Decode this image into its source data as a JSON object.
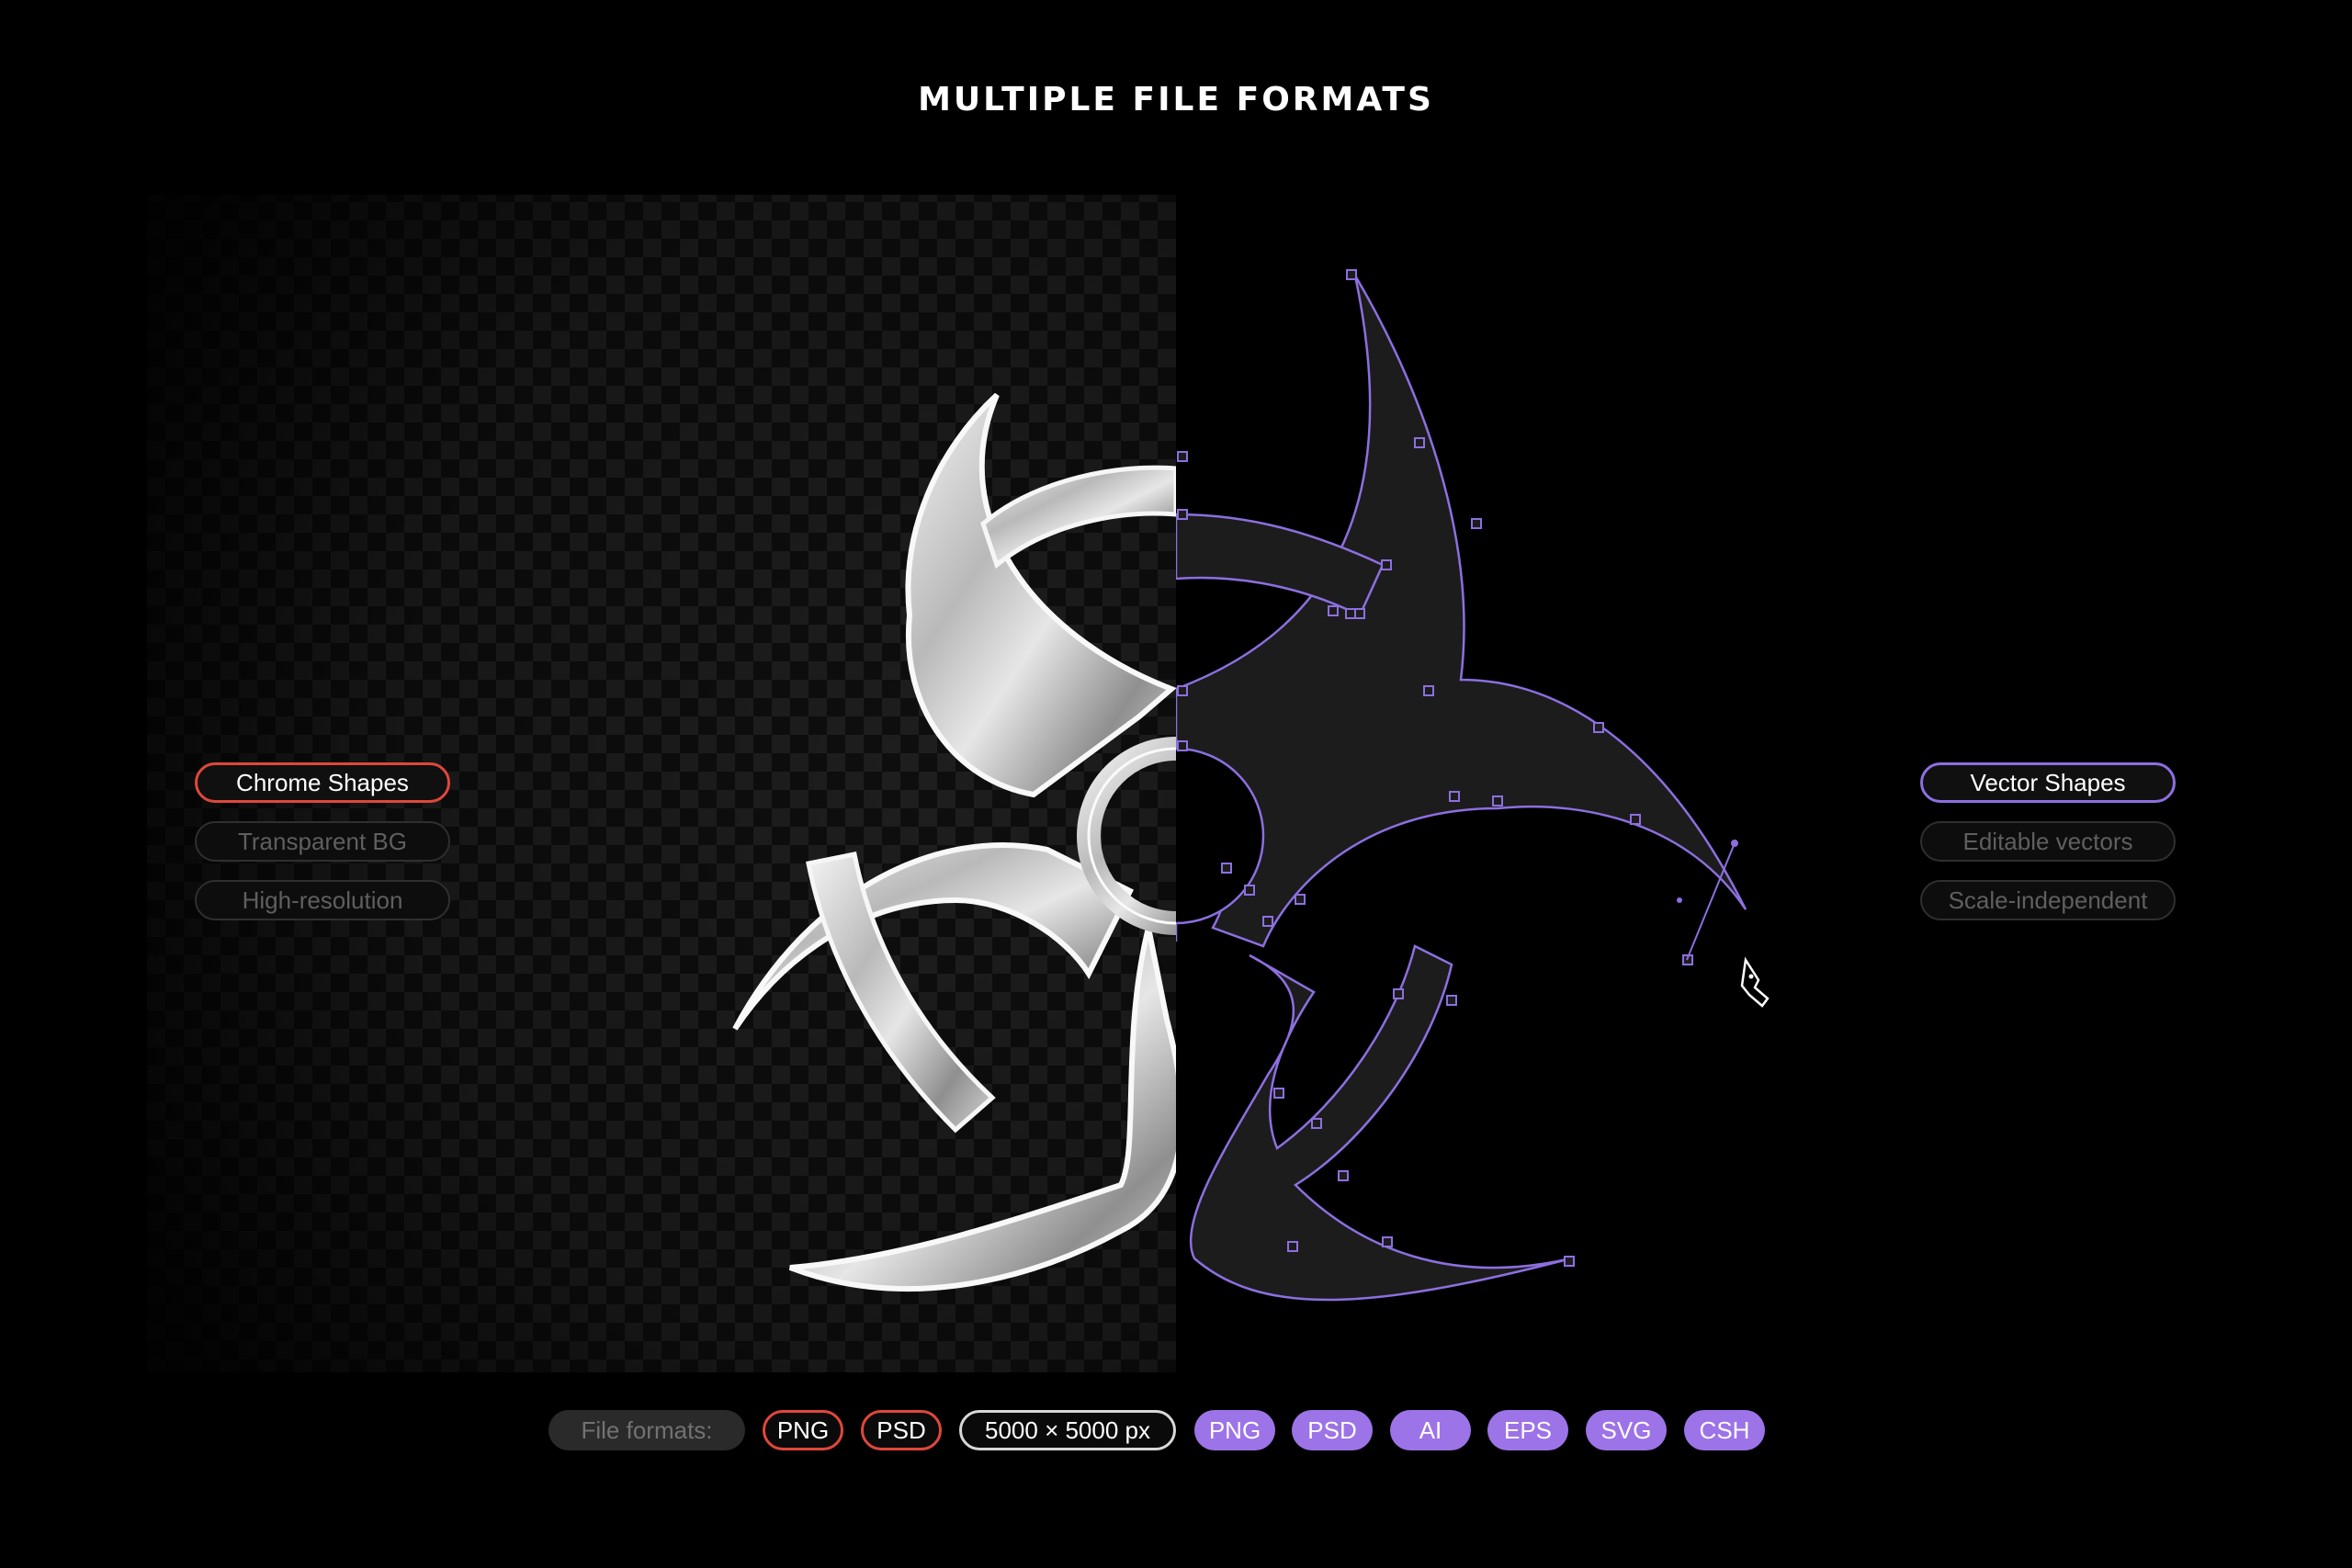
{
  "title": "MULTIPLE FILE FORMATS",
  "left_features": [
    {
      "label": "Chrome Shapes",
      "state": "active"
    },
    {
      "label": "Transparent BG",
      "state": "inactive"
    },
    {
      "label": "High-resolution",
      "state": "inactive"
    }
  ],
  "right_features": [
    {
      "label": "Vector Shapes",
      "state": "active"
    },
    {
      "label": "Editable vectors",
      "state": "inactive"
    },
    {
      "label": "Scale-independent",
      "state": "inactive"
    }
  ],
  "formats_bar": {
    "label": "File formats:",
    "raster": [
      "PNG",
      "PSD"
    ],
    "resolution": "5000 × 5000 px",
    "vector": [
      "PNG",
      "PSD",
      "AI",
      "EPS",
      "SVG",
      "CSH"
    ]
  },
  "colors": {
    "background": "#000000",
    "accent_red": "#e0473b",
    "accent_purple": "#9d73e8",
    "vector_outline": "#8d6fe0",
    "chrome": "#c8c8c8",
    "vector_fill": "#1c1c1c"
  },
  "icons": {
    "symbol": "biohazard-icon",
    "tool": "pen-tool-icon"
  }
}
